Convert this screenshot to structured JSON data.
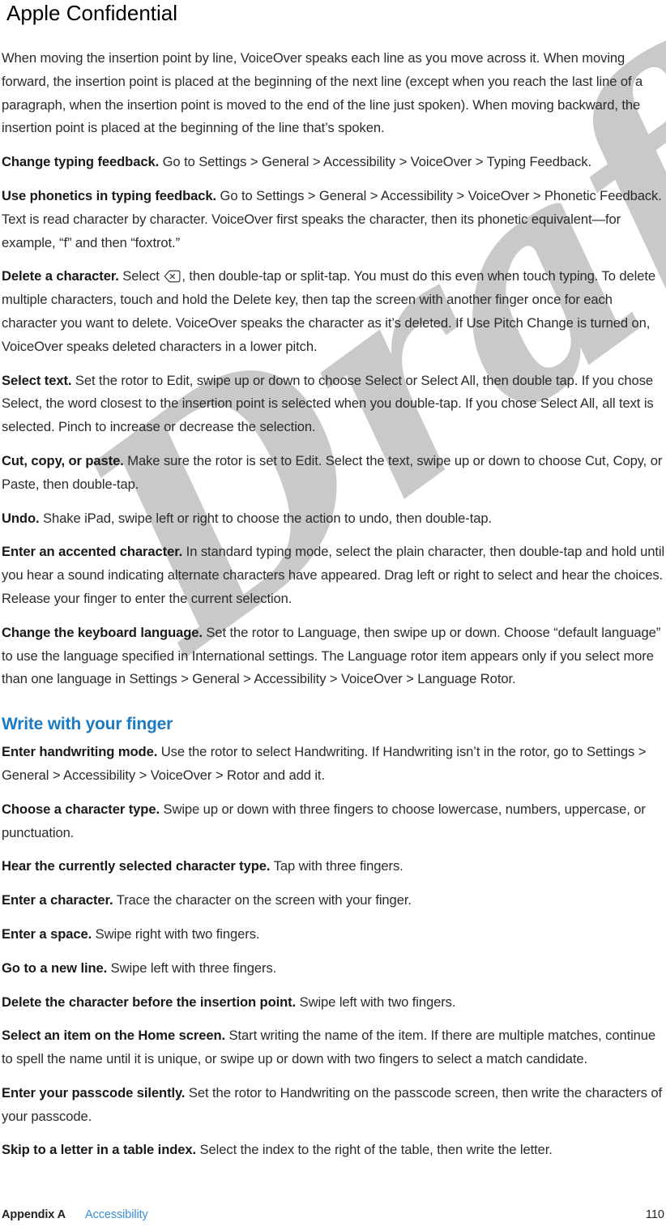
{
  "header": {
    "confidential_banner": "Apple Confidential"
  },
  "watermark": {
    "text": "Draft",
    "color": "#c9c9c9"
  },
  "theme": {
    "heading_blue": "#1b7ac4",
    "link_blue": "#3a8fd8",
    "body_text": "#2b2b2b"
  },
  "body": {
    "intro_paragraph": "When moving the insertion point by line, VoiceOver speaks each line as you move across it. When moving forward, the insertion point is placed at the beginning of the next line (except when you reach the last line of a paragraph, when the insertion point is moved to the end of the line just spoken). When moving backward, the insertion point is placed at the beginning of the line that’s spoken.",
    "entries": [
      {
        "lead": "Change typing feedback.",
        "text": " Go to Settings > General > Accessibility > VoiceOver > Typing Feedback."
      },
      {
        "lead": "Use phonetics in typing feedback.",
        "text": " Go to Settings > General > Accessibility > VoiceOver > Phonetic Feedback. Text is read character by character. VoiceOver first speaks the character, then its phonetic equivalent—for example, “f” and then “foxtrot.”"
      },
      {
        "lead": "Delete a character.",
        "text_before_icon": " Select ",
        "icon": "delete-key-icon",
        "text_after_icon": ", then double-tap or split-tap. You must do this even when touch typing. To delete multiple characters, touch and hold the Delete key, then tap the screen with another finger once for each character you want to delete. VoiceOver speaks the character as it’s deleted. If Use Pitch Change is turned on, VoiceOver speaks deleted characters in a lower pitch."
      },
      {
        "lead": "Select text.",
        "text": " Set the rotor to Edit, swipe up or down to choose Select or Select All, then double tap. If you chose Select, the word closest to the insertion point is selected when you double-tap. If you chose Select All, all text is selected. Pinch to increase or decrease the selection."
      },
      {
        "lead": "Cut, copy, or paste.",
        "text": " Make sure the rotor is set to Edit. Select the text, swipe up or down to choose Cut, Copy, or Paste, then double-tap."
      },
      {
        "lead": "Undo.",
        "text": " Shake iPad, swipe left or right to choose the action to undo, then double-tap."
      },
      {
        "lead": "Enter an accented character.",
        "text": " In standard typing mode, select the plain character, then double-tap and hold until you hear a sound indicating alternate characters have appeared. Drag left or right to select and hear the choices. Release your finger to enter the current selection."
      },
      {
        "lead": "Change the keyboard language.",
        "text": " Set the rotor to Language, then swipe up or down. Choose “default language” to use the language specified in International settings. The Language rotor item appears only if you select more than one language in Settings > General > Accessibility > VoiceOver > Language Rotor."
      }
    ],
    "section_heading": "Write with your finger",
    "section_entries": [
      {
        "lead": "Enter handwriting mode.",
        "text": " Use the rotor to select Handwriting. If Handwriting isn’t in the rotor, go to Settings > General > Accessibility > VoiceOver > Rotor and add it."
      },
      {
        "lead": "Choose a character type.",
        "text": " Swipe up or down with three fingers to choose lowercase, numbers, uppercase, or punctuation."
      },
      {
        "lead": "Hear the currently selected character type.",
        "text": " Tap with three fingers."
      },
      {
        "lead": "Enter a character.",
        "text": " Trace the character on the screen with your finger."
      },
      {
        "lead": "Enter a space.",
        "text": " Swipe right with two fingers."
      },
      {
        "lead": "Go to a new line.",
        "text": " Swipe left with three fingers."
      },
      {
        "lead": "Delete the character before the insertion point.",
        "text": " Swipe left with two fingers."
      },
      {
        "lead": "Select an item on the Home screen.",
        "text": " Start writing the name of the item. If there are multiple matches, continue to spell the name until it is unique, or swipe up or down with two fingers to select a match candidate."
      },
      {
        "lead": "Enter your passcode silently.",
        "text": " Set the rotor to Handwriting on the passcode screen, then write the characters of your passcode."
      },
      {
        "lead": "Skip to a letter in a table index.",
        "text": " Select the index to the right of the table, then write the letter."
      }
    ]
  },
  "footer": {
    "appendix": "Appendix A",
    "chapter": "Accessibility",
    "page_number": "110"
  }
}
